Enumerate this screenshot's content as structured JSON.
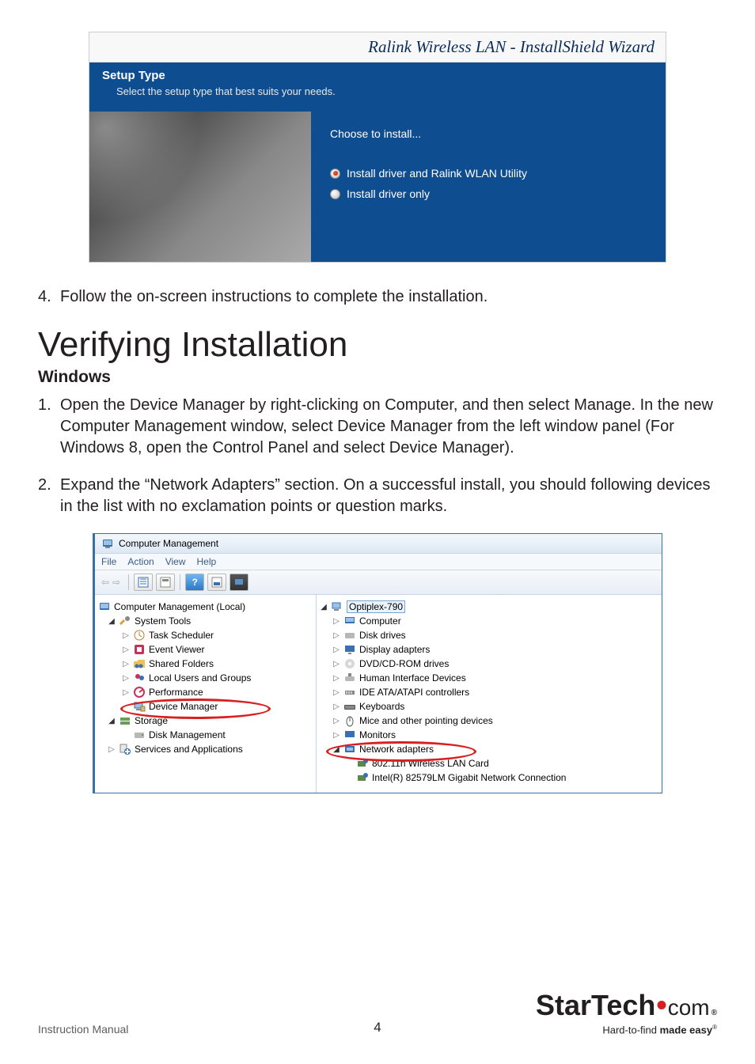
{
  "installer": {
    "title": "Ralink Wireless LAN - InstallShield Wizard",
    "setup_type": "Setup Type",
    "subtitle": "Select the setup type that best suits your needs.",
    "choose": "Choose to install...",
    "opt1": "Install driver and Ralink WLAN Utility",
    "opt2": "Install driver only"
  },
  "step4": {
    "num": "4.",
    "text": "Follow the on-screen instructions to complete the installation."
  },
  "heading": "Verifying Installation",
  "subheading": "Windows",
  "step1": {
    "num": "1.",
    "text": "Open the Device Manager by right-clicking on Computer, and then select Manage. In the new Computer Management window, select Device Manager from the left window panel (For Windows 8, open the Control Panel and select Device Manager)."
  },
  "step2": {
    "num": "2.",
    "text": "Expand the “Network Adapters” section. On a successful install, you should following devices in the list with no exclamation points or question marks."
  },
  "cm": {
    "title": "Computer Management",
    "menu": {
      "file": "File",
      "action": "Action",
      "view": "View",
      "help": "Help"
    },
    "left": {
      "root": "Computer Management (Local)",
      "systools": "System Tools",
      "task": "Task Scheduler",
      "event": "Event Viewer",
      "shared": "Shared Folders",
      "users": "Local Users and Groups",
      "perf": "Performance",
      "devmgr": "Device Manager",
      "storage": "Storage",
      "diskmgmt": "Disk Management",
      "services": "Services and Applications"
    },
    "right": {
      "root": "Optiplex-790",
      "computer": "Computer",
      "disk": "Disk drives",
      "display": "Display adapters",
      "dvd": "DVD/CD-ROM drives",
      "hid": "Human Interface Devices",
      "ide": "IDE ATA/ATAPI controllers",
      "kb": "Keyboards",
      "mice": "Mice and other pointing devices",
      "monitors": "Monitors",
      "network": "Network adapters",
      "wlan": "802.11n Wireless LAN Card",
      "intel": "Intel(R) 82579LM Gigabit Network Connection"
    }
  },
  "footer": {
    "manual": "Instruction Manual",
    "page": "4",
    "brand1": "StarTech",
    "brand2": "com",
    "tag1": "Hard-to-find ",
    "tag2": "made easy"
  }
}
